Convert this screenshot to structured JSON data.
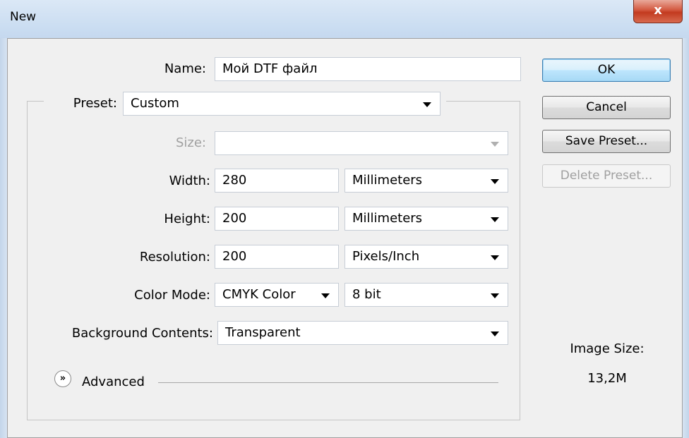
{
  "window": {
    "title": "New",
    "close_glyph": "x"
  },
  "form": {
    "name": {
      "label": "Name:",
      "value": "Мой DTF файл"
    },
    "preset": {
      "label": "Preset:",
      "value": "Custom"
    },
    "size": {
      "label": "Size:",
      "value": ""
    },
    "width": {
      "label": "Width:",
      "value": "280",
      "unit": "Millimeters"
    },
    "height": {
      "label": "Height:",
      "value": "200",
      "unit": "Millimeters"
    },
    "resolution": {
      "label": "Resolution:",
      "value": "200",
      "unit": "Pixels/Inch"
    },
    "color_mode": {
      "label": "Color Mode:",
      "value": "CMYK Color",
      "depth": "8 bit"
    },
    "background": {
      "label": "Background Contents:",
      "value": "Transparent"
    },
    "advanced": {
      "label": "Advanced",
      "icon": "chevron-double-down-icon"
    }
  },
  "buttons": {
    "ok": "OK",
    "cancel": "Cancel",
    "save_preset": "Save Preset...",
    "delete_preset": "Delete Preset..."
  },
  "image_size": {
    "label": "Image Size:",
    "value": "13,2M"
  }
}
